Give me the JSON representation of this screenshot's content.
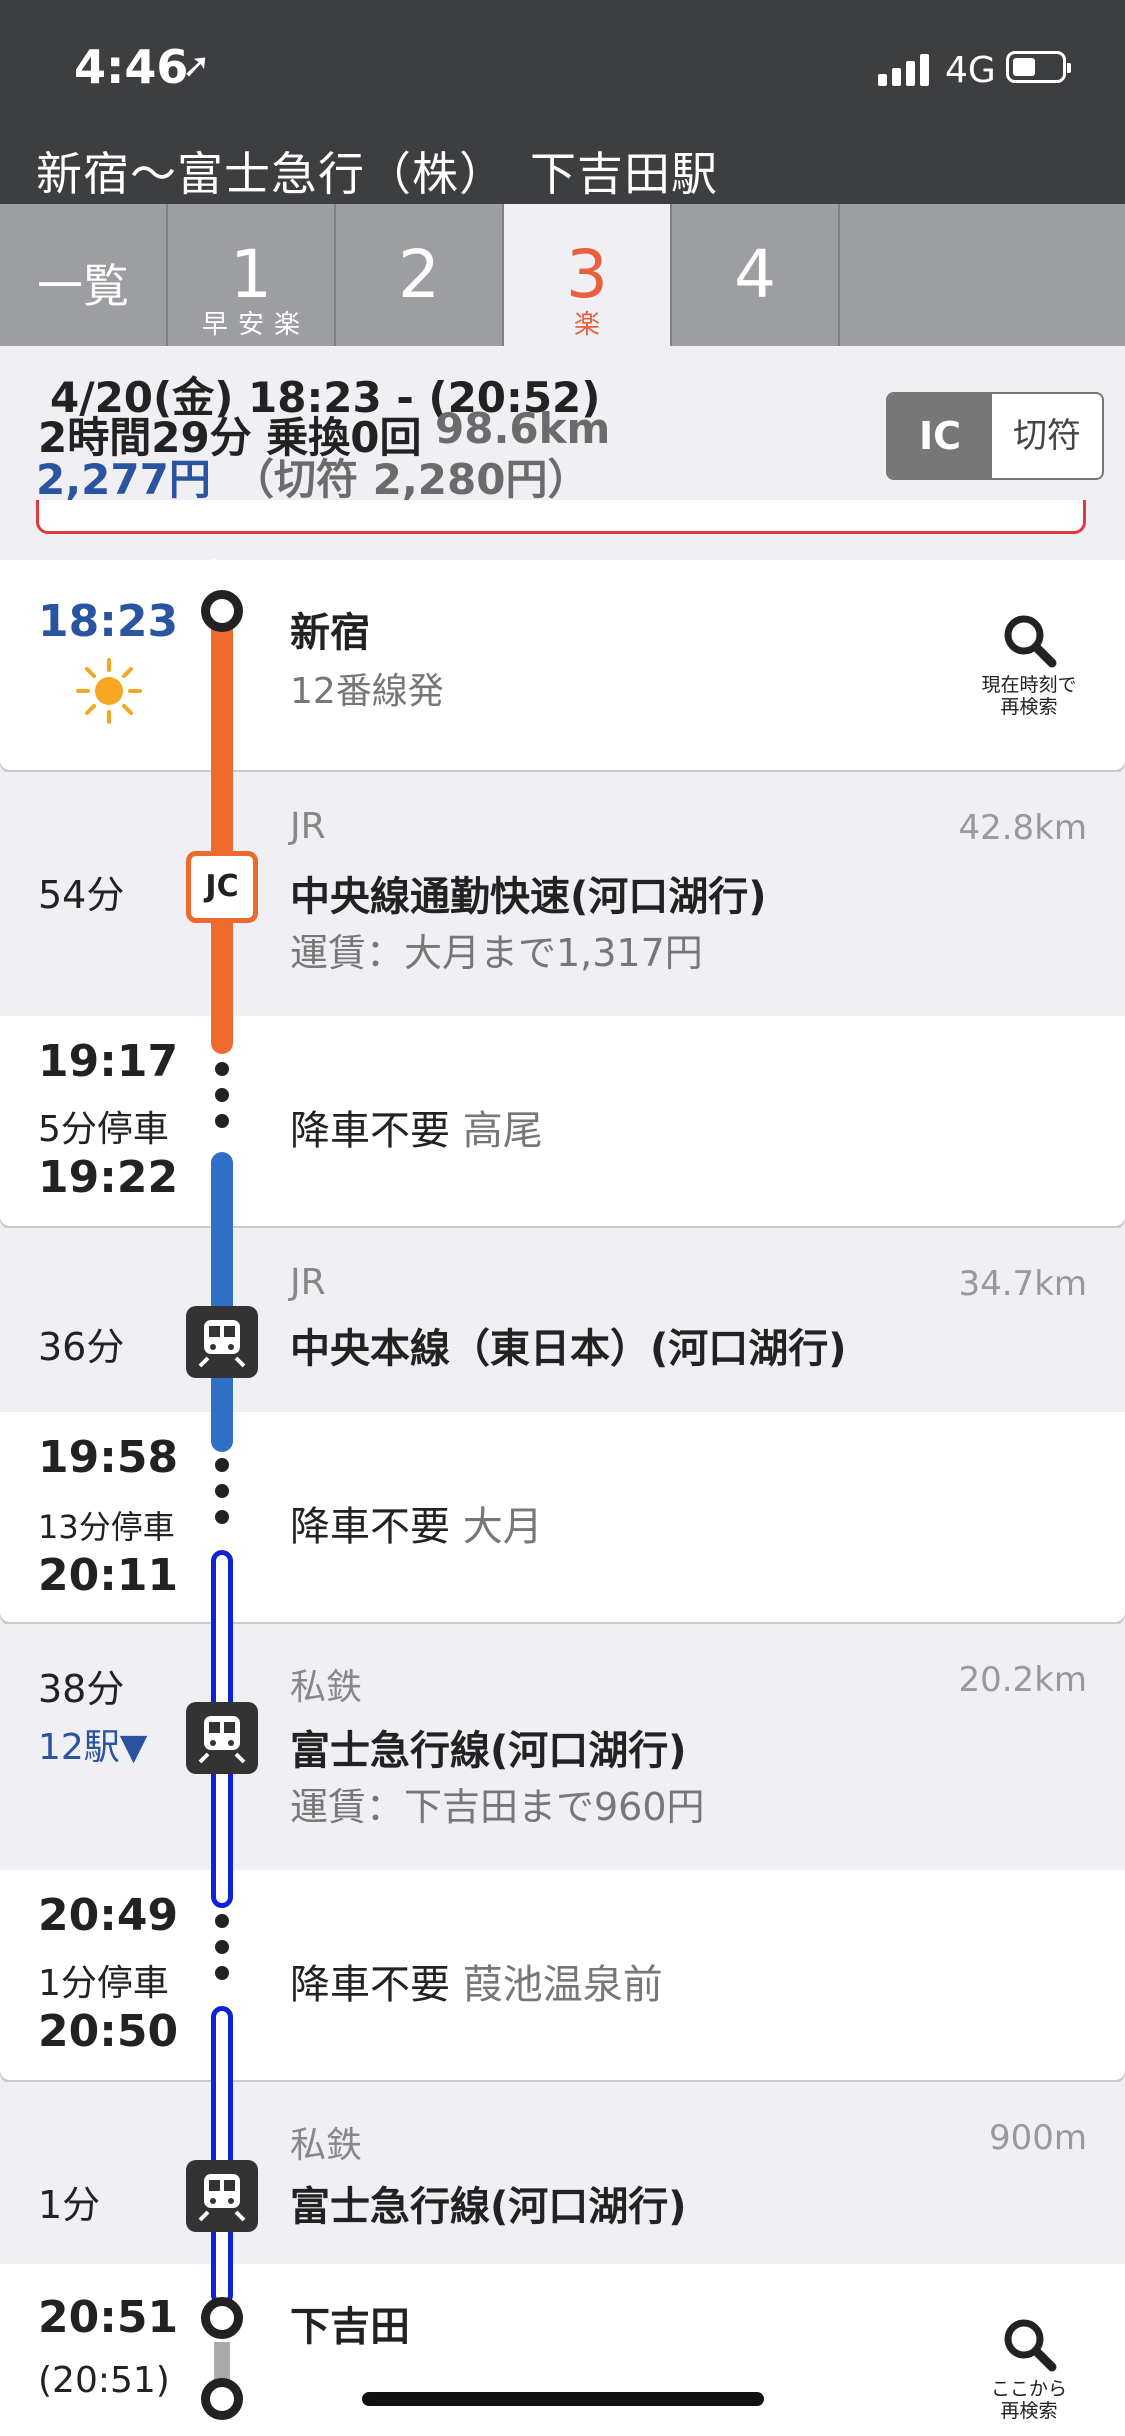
{
  "status": {
    "time": "4:46",
    "network": "4G"
  },
  "title": "新宿〜富士急行（株）　下吉田駅",
  "tabs": [
    {
      "label": "一覧",
      "sub": ""
    },
    {
      "label": "1",
      "sub": "早安楽"
    },
    {
      "label": "2",
      "sub": ""
    },
    {
      "label": "3",
      "sub": "楽",
      "active": true
    },
    {
      "label": "4",
      "sub": ""
    }
  ],
  "summary": {
    "date_time": "4/20(金) 18:23 - (20:52)",
    "duration": "2時間29分 乗換0回",
    "distance": "98.6km",
    "price": "2,277円",
    "ticket_price": "（切符 2,280円）",
    "fare_ic": "IC",
    "fare_ticket": "切符"
  },
  "itinerary": {
    "depart": {
      "time": "18:23",
      "station": "新宿",
      "platform": "12番線発",
      "search_label_1": "現在時刻で",
      "search_label_2": "再検索"
    },
    "seg1": {
      "duration": "54分",
      "company": "JR",
      "line": "中央線通勤快速(河口湖行)",
      "fare": "運賃：大月まで1,317円",
      "distance": "42.8km",
      "badge": "JC"
    },
    "stop1": {
      "arrive": "19:17",
      "wait": "5分停車",
      "depart": "19:22",
      "text": "降車不要",
      "station": "高尾"
    },
    "seg2": {
      "duration": "36分",
      "company": "JR",
      "line": "中央本線（東日本）(河口湖行)",
      "distance": "34.7km"
    },
    "stop2": {
      "arrive": "19:58",
      "wait": "13分停車",
      "depart": "20:11",
      "text": "降車不要",
      "station": "大月"
    },
    "seg3": {
      "duration": "38分",
      "stations": "12駅▼",
      "company": "私鉄",
      "line": "富士急行線(河口湖行)",
      "fare": "運賃：下吉田まで960円",
      "distance": "20.2km"
    },
    "stop3": {
      "arrive": "20:49",
      "wait": "1分停車",
      "depart": "20:50",
      "text": "降車不要",
      "station": "葭池温泉前"
    },
    "seg4": {
      "duration": "1分",
      "company": "私鉄",
      "line": "富士急行線(河口湖行)",
      "distance": "900m"
    },
    "arrive": {
      "time": "20:51",
      "time2": "(20:51)",
      "station": "下吉田",
      "search_label_1": "ここから",
      "search_label_2": "再検索"
    }
  },
  "colors": {
    "orange_line": "#ee6a2c",
    "blue_line": "#2f6fc6",
    "navy_line": "#1022d8",
    "accent_blue": "#2a54a0",
    "active_tab": "#e8603c"
  }
}
